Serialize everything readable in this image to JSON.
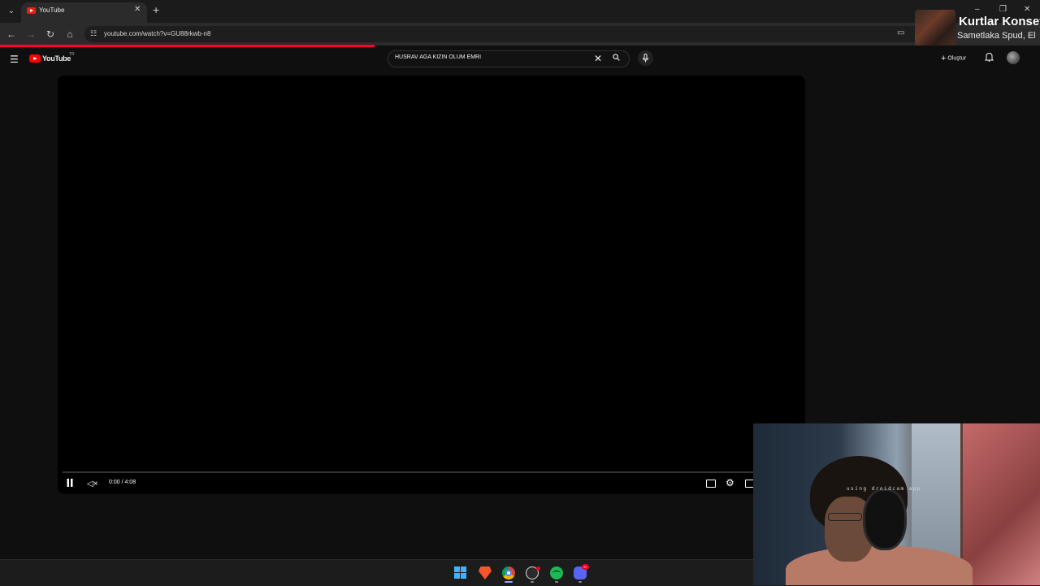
{
  "browser": {
    "tab_title": "YouTube",
    "url": "youtube.com/watch?v=GU88rkwb-n8",
    "page_load_progress": 0.36
  },
  "media_notification": {
    "title": "Kurtlar Konseyi",
    "artist": "Sametlaka Spud, El"
  },
  "youtube": {
    "logo_text": "YouTube",
    "country_code": "TR",
    "search_query": "HÜSRAV AĞA KIZIN ÖLÜM EMRİ",
    "create_label": "Oluştur"
  },
  "player": {
    "time_display": "0:00 / 4:08",
    "progress": 0.0,
    "state": "playing",
    "muted": true
  },
  "webcam": {
    "overlay_text": "using droidcam app"
  },
  "taskbar": {
    "discord_badge": "9+"
  },
  "colors": {
    "youtube_red": "#ff0000",
    "load_bar": "#ff0033",
    "page_bg": "#0f0f0f"
  },
  "icons": [
    "tab-list-icon",
    "youtube-favicon",
    "close-icon",
    "plus-icon",
    "back-icon",
    "forward-icon",
    "reload-icon",
    "home-icon",
    "site-info-icon",
    "cast-icon",
    "hamburger-menu-icon",
    "youtube-logo-icon",
    "search-icon",
    "mic-icon",
    "create-plus-icon",
    "bell-icon",
    "pause-icon",
    "mute-icon",
    "subtitles-icon",
    "settings-icon",
    "miniplayer-icon",
    "windows-start-icon",
    "brave-icon",
    "chrome-icon",
    "obs-icon",
    "spotify-icon",
    "discord-icon"
  ]
}
